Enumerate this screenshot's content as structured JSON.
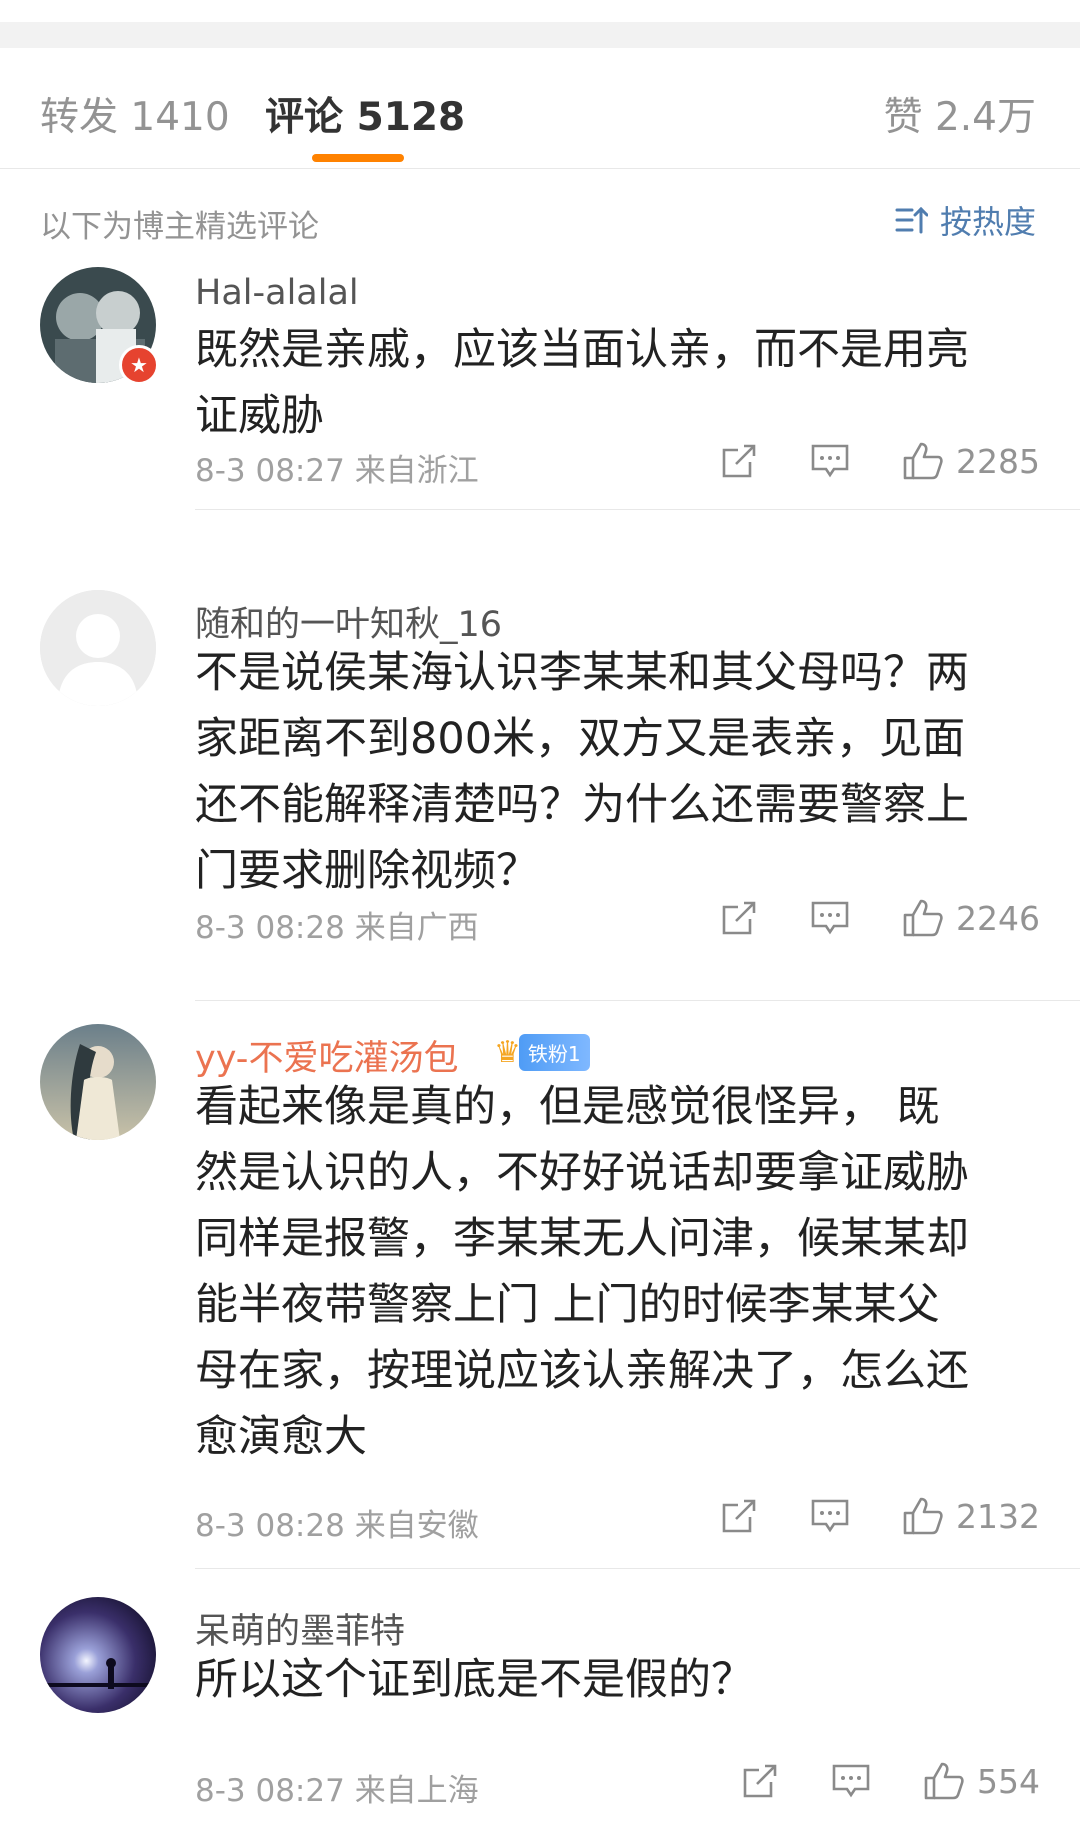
{
  "tabs": {
    "repost": "转发 1410",
    "comment": "评论 5128",
    "like": "赞 2.4万"
  },
  "filter": {
    "label": "以下为博主精选评论",
    "sort": "按热度"
  },
  "comments": [
    {
      "username": "Hal-alalal",
      "content": "既然是亲戚，应该当面认亲，而不是用亮\n证威胁",
      "time": "8-3 08:27",
      "location": "来自浙江",
      "likes": "2285"
    },
    {
      "username": "随和的一叶知秋_16",
      "content": "不是说侯某海认识李某某和其父母吗？两\n家距离不到800米，双方又是表亲，见面\n还不能解释清楚吗？为什么还需要警察上\n门要求删除视频？",
      "time": "8-3 08:28",
      "location": "来自广西",
      "likes": "2246"
    },
    {
      "username": "yy-不爱吃灌汤包",
      "fan_badge": "铁粉1",
      "content": "看起来像是真的，但是感觉很怪异， 既\n然是认识的人，不好好说话却要拿证威胁\n同样是报警，李某某无人问津，候某某却\n能半夜带警察上门 上门的时候李某某父\n母在家，按理说应该认亲解决了，怎么还\n愈演愈大",
      "time": "8-3 08:28",
      "location": "来自安徽",
      "likes": "2132"
    },
    {
      "username": "呆萌的墨菲特",
      "content": "所以这个证到底是不是假的？",
      "time": "8-3 08:27",
      "location": "来自上海",
      "likes": "554"
    }
  ],
  "colors": {
    "accent": "#ff8200",
    "link": "#507daf",
    "vip_name": "#eb7350"
  }
}
